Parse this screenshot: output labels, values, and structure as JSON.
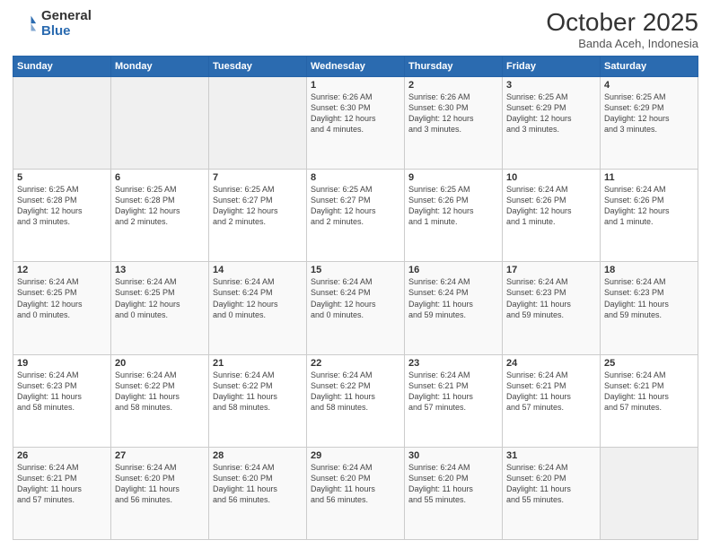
{
  "header": {
    "logo_general": "General",
    "logo_blue": "Blue",
    "title": "October 2025",
    "location": "Banda Aceh, Indonesia"
  },
  "days_of_week": [
    "Sunday",
    "Monday",
    "Tuesday",
    "Wednesday",
    "Thursday",
    "Friday",
    "Saturday"
  ],
  "weeks": [
    [
      {
        "day": "",
        "info": ""
      },
      {
        "day": "",
        "info": ""
      },
      {
        "day": "",
        "info": ""
      },
      {
        "day": "1",
        "info": "Sunrise: 6:26 AM\nSunset: 6:30 PM\nDaylight: 12 hours\nand 4 minutes."
      },
      {
        "day": "2",
        "info": "Sunrise: 6:26 AM\nSunset: 6:30 PM\nDaylight: 12 hours\nand 3 minutes."
      },
      {
        "day": "3",
        "info": "Sunrise: 6:25 AM\nSunset: 6:29 PM\nDaylight: 12 hours\nand 3 minutes."
      },
      {
        "day": "4",
        "info": "Sunrise: 6:25 AM\nSunset: 6:29 PM\nDaylight: 12 hours\nand 3 minutes."
      }
    ],
    [
      {
        "day": "5",
        "info": "Sunrise: 6:25 AM\nSunset: 6:28 PM\nDaylight: 12 hours\nand 3 minutes."
      },
      {
        "day": "6",
        "info": "Sunrise: 6:25 AM\nSunset: 6:28 PM\nDaylight: 12 hours\nand 2 minutes."
      },
      {
        "day": "7",
        "info": "Sunrise: 6:25 AM\nSunset: 6:27 PM\nDaylight: 12 hours\nand 2 minutes."
      },
      {
        "day": "8",
        "info": "Sunrise: 6:25 AM\nSunset: 6:27 PM\nDaylight: 12 hours\nand 2 minutes."
      },
      {
        "day": "9",
        "info": "Sunrise: 6:25 AM\nSunset: 6:26 PM\nDaylight: 12 hours\nand 1 minute."
      },
      {
        "day": "10",
        "info": "Sunrise: 6:24 AM\nSunset: 6:26 PM\nDaylight: 12 hours\nand 1 minute."
      },
      {
        "day": "11",
        "info": "Sunrise: 6:24 AM\nSunset: 6:26 PM\nDaylight: 12 hours\nand 1 minute."
      }
    ],
    [
      {
        "day": "12",
        "info": "Sunrise: 6:24 AM\nSunset: 6:25 PM\nDaylight: 12 hours\nand 0 minutes."
      },
      {
        "day": "13",
        "info": "Sunrise: 6:24 AM\nSunset: 6:25 PM\nDaylight: 12 hours\nand 0 minutes."
      },
      {
        "day": "14",
        "info": "Sunrise: 6:24 AM\nSunset: 6:24 PM\nDaylight: 12 hours\nand 0 minutes."
      },
      {
        "day": "15",
        "info": "Sunrise: 6:24 AM\nSunset: 6:24 PM\nDaylight: 12 hours\nand 0 minutes."
      },
      {
        "day": "16",
        "info": "Sunrise: 6:24 AM\nSunset: 6:24 PM\nDaylight: 11 hours\nand 59 minutes."
      },
      {
        "day": "17",
        "info": "Sunrise: 6:24 AM\nSunset: 6:23 PM\nDaylight: 11 hours\nand 59 minutes."
      },
      {
        "day": "18",
        "info": "Sunrise: 6:24 AM\nSunset: 6:23 PM\nDaylight: 11 hours\nand 59 minutes."
      }
    ],
    [
      {
        "day": "19",
        "info": "Sunrise: 6:24 AM\nSunset: 6:23 PM\nDaylight: 11 hours\nand 58 minutes."
      },
      {
        "day": "20",
        "info": "Sunrise: 6:24 AM\nSunset: 6:22 PM\nDaylight: 11 hours\nand 58 minutes."
      },
      {
        "day": "21",
        "info": "Sunrise: 6:24 AM\nSunset: 6:22 PM\nDaylight: 11 hours\nand 58 minutes."
      },
      {
        "day": "22",
        "info": "Sunrise: 6:24 AM\nSunset: 6:22 PM\nDaylight: 11 hours\nand 58 minutes."
      },
      {
        "day": "23",
        "info": "Sunrise: 6:24 AM\nSunset: 6:21 PM\nDaylight: 11 hours\nand 57 minutes."
      },
      {
        "day": "24",
        "info": "Sunrise: 6:24 AM\nSunset: 6:21 PM\nDaylight: 11 hours\nand 57 minutes."
      },
      {
        "day": "25",
        "info": "Sunrise: 6:24 AM\nSunset: 6:21 PM\nDaylight: 11 hours\nand 57 minutes."
      }
    ],
    [
      {
        "day": "26",
        "info": "Sunrise: 6:24 AM\nSunset: 6:21 PM\nDaylight: 11 hours\nand 57 minutes."
      },
      {
        "day": "27",
        "info": "Sunrise: 6:24 AM\nSunset: 6:20 PM\nDaylight: 11 hours\nand 56 minutes."
      },
      {
        "day": "28",
        "info": "Sunrise: 6:24 AM\nSunset: 6:20 PM\nDaylight: 11 hours\nand 56 minutes."
      },
      {
        "day": "29",
        "info": "Sunrise: 6:24 AM\nSunset: 6:20 PM\nDaylight: 11 hours\nand 56 minutes."
      },
      {
        "day": "30",
        "info": "Sunrise: 6:24 AM\nSunset: 6:20 PM\nDaylight: 11 hours\nand 55 minutes."
      },
      {
        "day": "31",
        "info": "Sunrise: 6:24 AM\nSunset: 6:20 PM\nDaylight: 11 hours\nand 55 minutes."
      },
      {
        "day": "",
        "info": ""
      }
    ]
  ]
}
